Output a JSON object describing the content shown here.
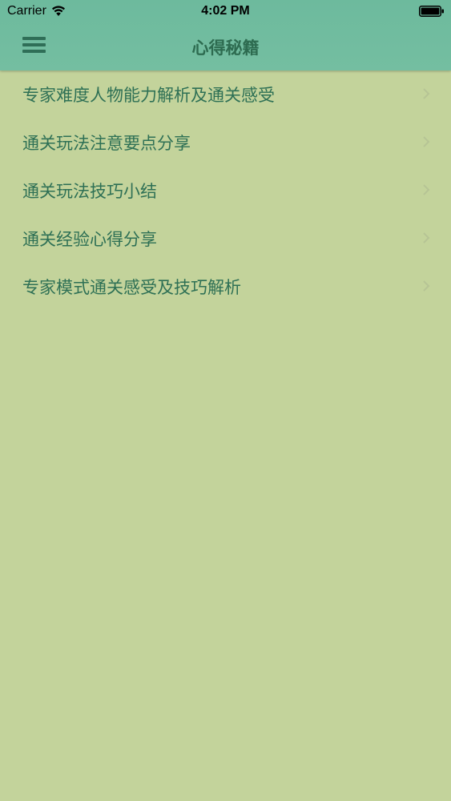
{
  "status_bar": {
    "carrier": "Carrier",
    "time": "4:02 PM"
  },
  "nav": {
    "title": "心得秘籍",
    "menu_icon": "hamburger-menu-icon"
  },
  "list": {
    "items": [
      {
        "label": "专家难度人物能力解析及通关感受"
      },
      {
        "label": "通关玩法注意要点分享"
      },
      {
        "label": "通关玩法技巧小结"
      },
      {
        "label": "通关经验心得分享"
      },
      {
        "label": "专家模式通关感受及技巧解析"
      }
    ]
  },
  "colors": {
    "header": "#6dba9d",
    "background": "#c3d39b",
    "text": "#2e7055"
  }
}
